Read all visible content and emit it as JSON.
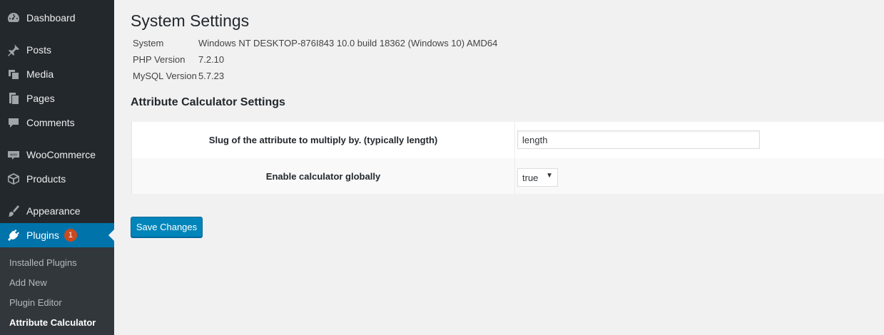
{
  "sidebar": {
    "items": [
      {
        "label": "Dashboard",
        "icon": "dashboard-icon"
      },
      {
        "label": "Posts",
        "icon": "pin-icon"
      },
      {
        "label": "Media",
        "icon": "media-icon"
      },
      {
        "label": "Pages",
        "icon": "pages-icon"
      },
      {
        "label": "Comments",
        "icon": "comment-icon"
      },
      {
        "label": "WooCommerce",
        "icon": "woo-icon"
      },
      {
        "label": "Products",
        "icon": "box-icon"
      },
      {
        "label": "Appearance",
        "icon": "brush-icon"
      },
      {
        "label": "Plugins",
        "icon": "plug-icon",
        "badge": "1"
      }
    ],
    "submenu": [
      {
        "label": "Installed Plugins"
      },
      {
        "label": "Add New"
      },
      {
        "label": "Plugin Editor"
      },
      {
        "label": "Attribute Calculator"
      }
    ],
    "accent_color": "#0073aa",
    "badge_color": "#ca4a1f"
  },
  "main": {
    "title": "System Settings",
    "system_info": [
      {
        "key": "System",
        "value": "Windows NT DESKTOP-876I843 10.0 build 18362 (Windows 10) AMD64"
      },
      {
        "key": "PHP Version",
        "value": "7.2.10"
      },
      {
        "key": "MySQL Version",
        "value": "5.7.23"
      }
    ],
    "section_title": "Attribute Calculator Settings",
    "fields": {
      "slug": {
        "label": "Slug of the attribute to multiply by. (typically length)",
        "value": "length"
      },
      "enable": {
        "label": "Enable calculator globally",
        "value": "true"
      }
    },
    "save_label": "Save Changes",
    "button_color": "#0085ba"
  }
}
